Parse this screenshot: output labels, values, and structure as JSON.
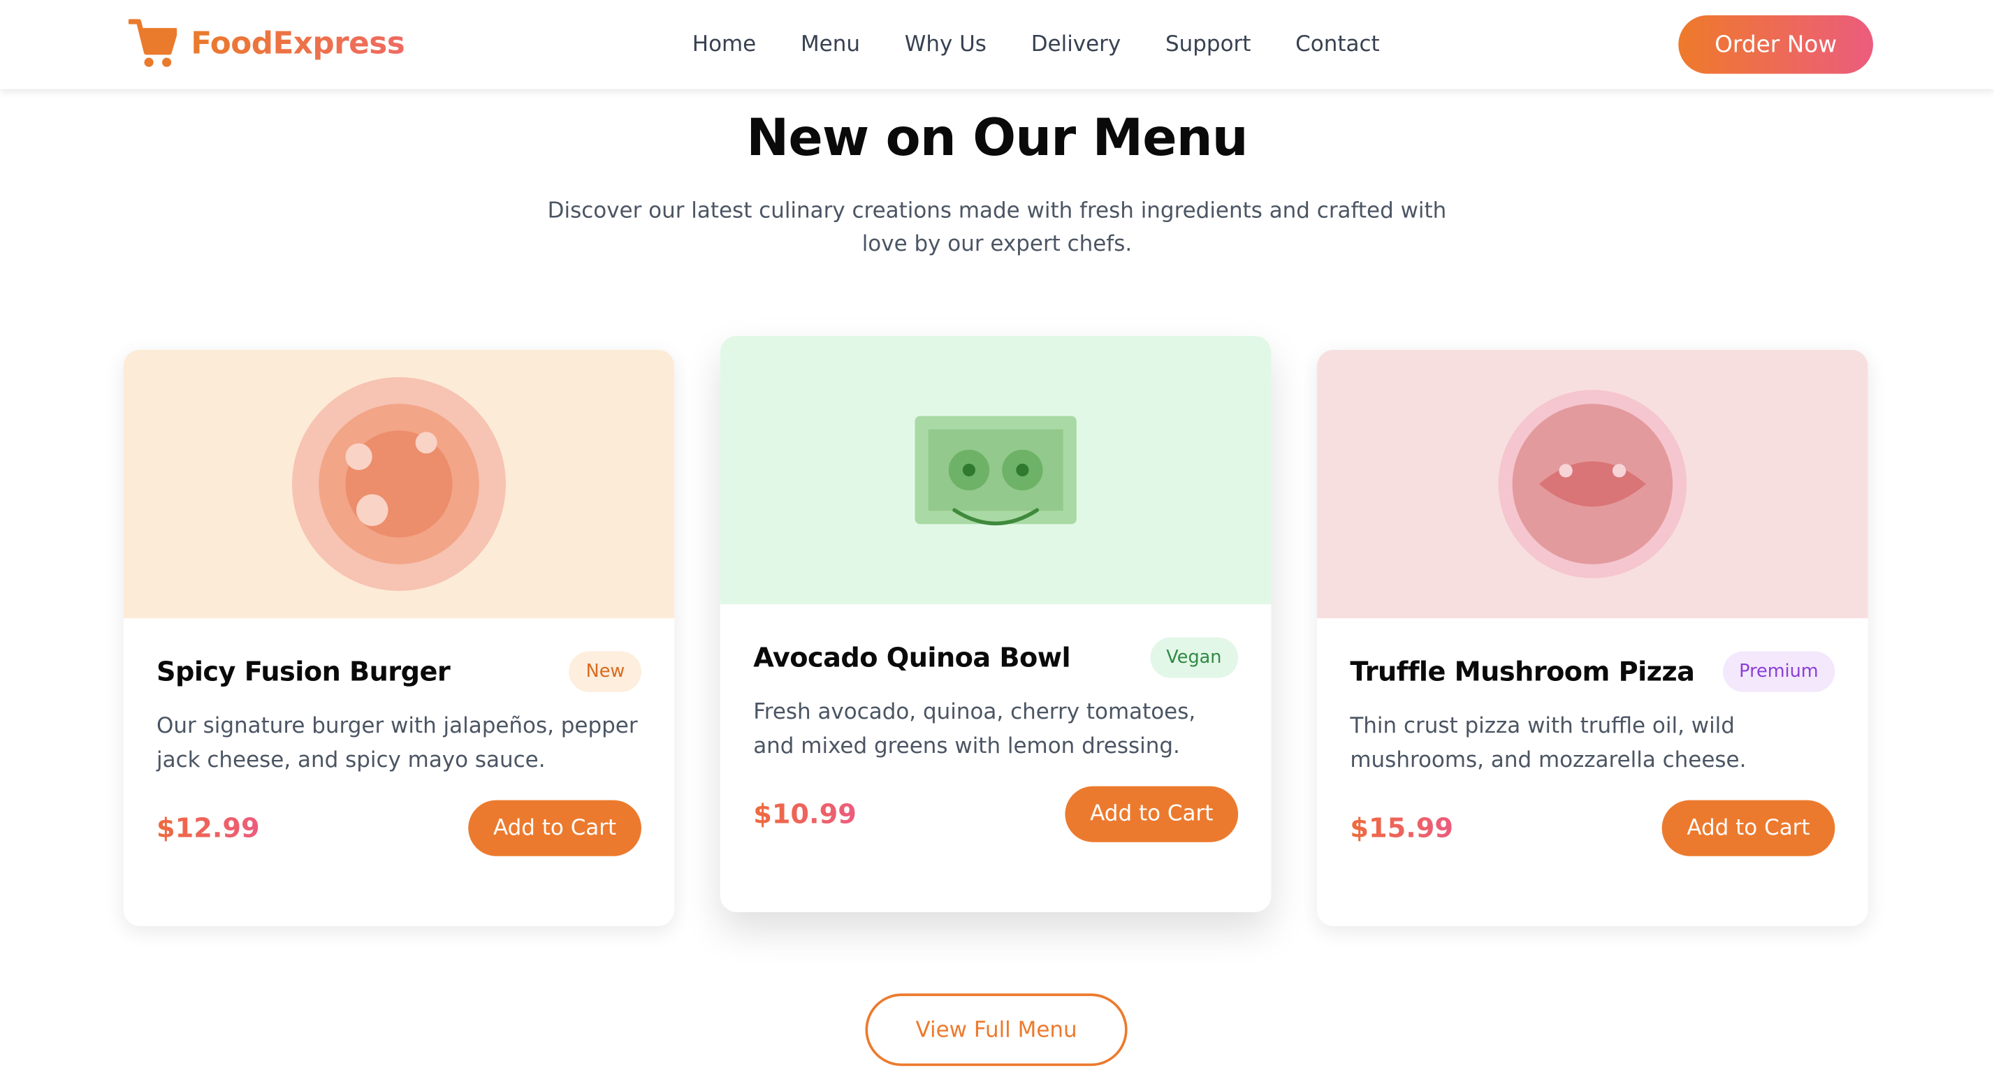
{
  "brand": {
    "name": "FoodExpress",
    "color": "#ea7a2c"
  },
  "nav": {
    "items": [
      {
        "label": "Home"
      },
      {
        "label": "Menu"
      },
      {
        "label": "Why Us"
      },
      {
        "label": "Delivery"
      },
      {
        "label": "Support"
      },
      {
        "label": "Contact"
      }
    ],
    "cta_label": "Order Now"
  },
  "section": {
    "title": "New on Our Menu",
    "subtitle": "Discover our latest culinary creations made with fresh ingredients and crafted with love by our expert chefs."
  },
  "cards": [
    {
      "title": "Spicy Fusion Burger",
      "badge": "New",
      "badge_bg": "#fdeedd",
      "badge_color": "#d86b1f",
      "description": "Our signature burger with jalapeños, pepper jack cheese, and spicy mayo sauce.",
      "price": "$12.99",
      "button_label": "Add to Cart",
      "media_bg": "#fcebd7",
      "icon": "burger-illustration-icon"
    },
    {
      "title": "Avocado Quinoa Bowl",
      "badge": "Vegan",
      "badge_bg": "#e3f7e8",
      "badge_color": "#2f8a44",
      "description": "Fresh avocado, quinoa, cherry tomatoes, and mixed greens with lemon dressing.",
      "price": "$10.99",
      "button_label": "Add to Cart",
      "media_bg": "#e2f8e7",
      "icon": "bowl-illustration-icon"
    },
    {
      "title": "Truffle Mushroom Pizza",
      "badge": "Premium",
      "badge_bg": "#f3e8fc",
      "badge_color": "#8b3fd6",
      "description": "Thin crust pizza with truffle oil, wild mushrooms, and mozzarella cheese.",
      "price": "$15.99",
      "button_label": "Add to Cart",
      "media_bg": "#f8dfdf",
      "icon": "pizza-illustration-icon"
    }
  ],
  "footer_cta": {
    "label": "View Full Menu"
  },
  "colors": {
    "accent": "#ec7a2e",
    "accent_pink": "#ec5c7e",
    "text_dark": "#0a0a0a",
    "text_muted": "#4b5563"
  }
}
